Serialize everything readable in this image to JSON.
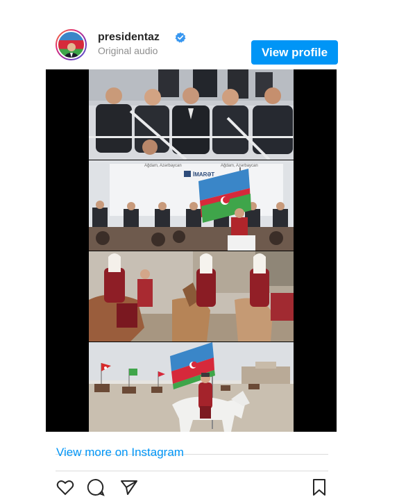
{
  "header": {
    "username": "presidentaz",
    "verified_icon": "verified-badge-icon",
    "subtitle": "Original audio",
    "view_profile_label": "View profile"
  },
  "media": {
    "panels": [
      {
        "name": "officials-in-stands"
      },
      {
        "name": "stage-with-flag",
        "sign_text_1": "Ağdam, Azərbaycan",
        "sign_text_2": "Ağdam, Azərbaycan",
        "brand": "İMARƏT"
      },
      {
        "name": "riders-in-costume"
      },
      {
        "name": "rider-with-flag"
      }
    ]
  },
  "footer": {
    "view_more_label": "View more on Instagram"
  },
  "actions": {
    "icons": [
      "heart-icon",
      "comment-icon",
      "share-icon",
      "bookmark-icon"
    ]
  },
  "colors": {
    "accent": "#0095f6",
    "flag_blue": "#3a86c8",
    "flag_red": "#d6293b",
    "flag_green": "#3fa54a"
  }
}
